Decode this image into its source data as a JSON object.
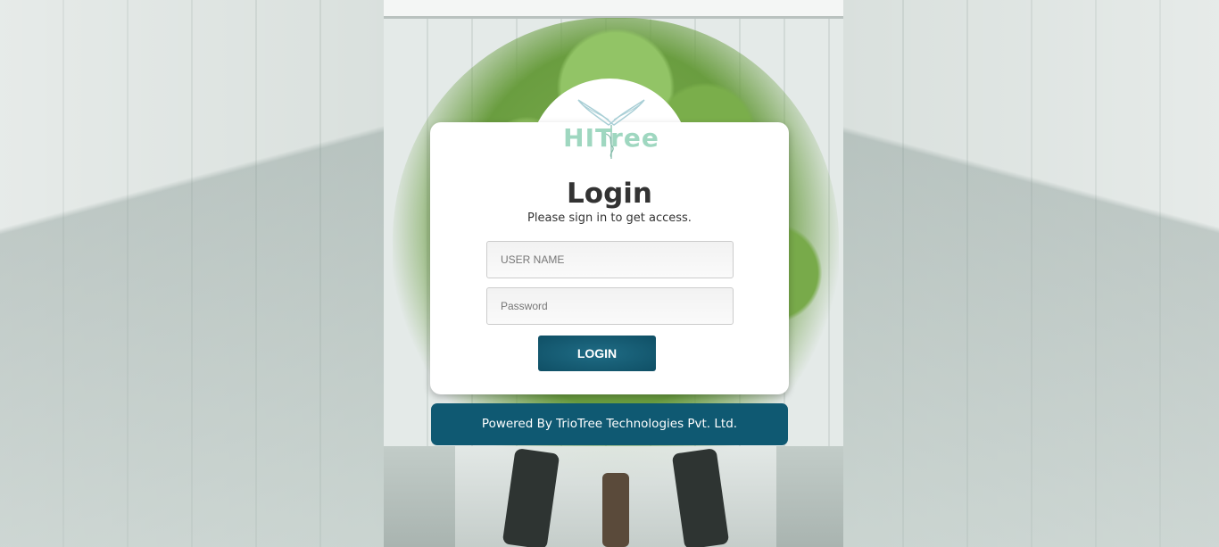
{
  "brand": {
    "logo_text": "HITree",
    "logo_color": "#9fd7c0"
  },
  "login": {
    "title": "Login",
    "subtitle": "Please sign in to get access.",
    "username_placeholder": "USER NAME",
    "password_placeholder": "Password",
    "button_label": "LOGIN"
  },
  "footer": {
    "powered_by": "Powered By TrioTree Technologies Pvt. Ltd."
  },
  "colors": {
    "accent": "#0f5972",
    "card": "#ffffff",
    "text": "#333333"
  }
}
